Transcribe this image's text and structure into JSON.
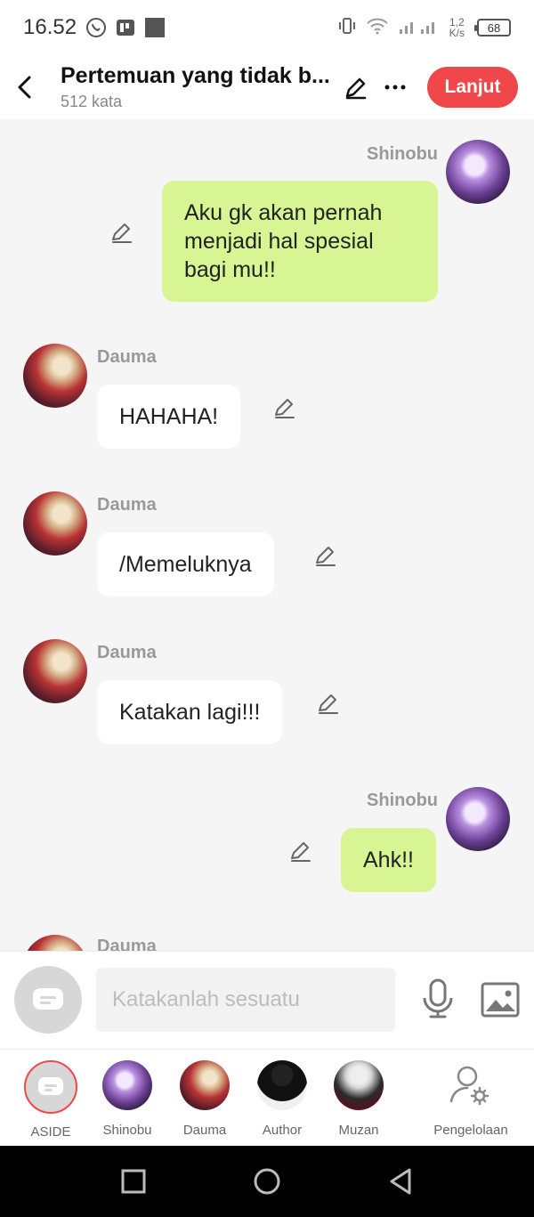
{
  "status_bar": {
    "time": "16.52",
    "speed_value": "1,2",
    "speed_unit": "K/s",
    "battery": "68"
  },
  "header": {
    "title": "Pertemuan yang tidak b...",
    "word_count": "512 kata",
    "continue_label": "Lanjut"
  },
  "messages": [
    {
      "sender": "Shinobu",
      "text": "Aku gk akan pernah menjadi hal spesial bagi mu!!",
      "side": "right"
    },
    {
      "sender": "Dauma",
      "text": "HAHAHA!",
      "side": "left"
    },
    {
      "sender": "Dauma",
      "text": "/Memeluknya",
      "side": "left"
    },
    {
      "sender": "Dauma",
      "text": "Katakan lagi!!!",
      "side": "left"
    },
    {
      "sender": "Shinobu",
      "text": "Ahk!!",
      "side": "right"
    },
    {
      "sender": "Dauma",
      "text": "",
      "side": "left"
    }
  ],
  "input": {
    "placeholder": "Katakanlah sesuatu"
  },
  "characters": [
    {
      "label": "ASIDE"
    },
    {
      "label": "Shinobu"
    },
    {
      "label": "Dauma"
    },
    {
      "label": "Author"
    },
    {
      "label": "Muzan"
    },
    {
      "label": "Pengelolaan"
    }
  ],
  "colors": {
    "accent": "#f0474b",
    "my_bubble": "#d8f593",
    "other_bubble": "#ffffff",
    "background": "#f5f5f5"
  },
  "icons": {
    "back": "chevron-left-icon",
    "edit": "pencil-icon",
    "more": "more-horizontal-icon",
    "aside": "chat-bubble-icon",
    "mic": "microphone-icon",
    "image": "image-icon",
    "manage": "user-settings-icon"
  }
}
